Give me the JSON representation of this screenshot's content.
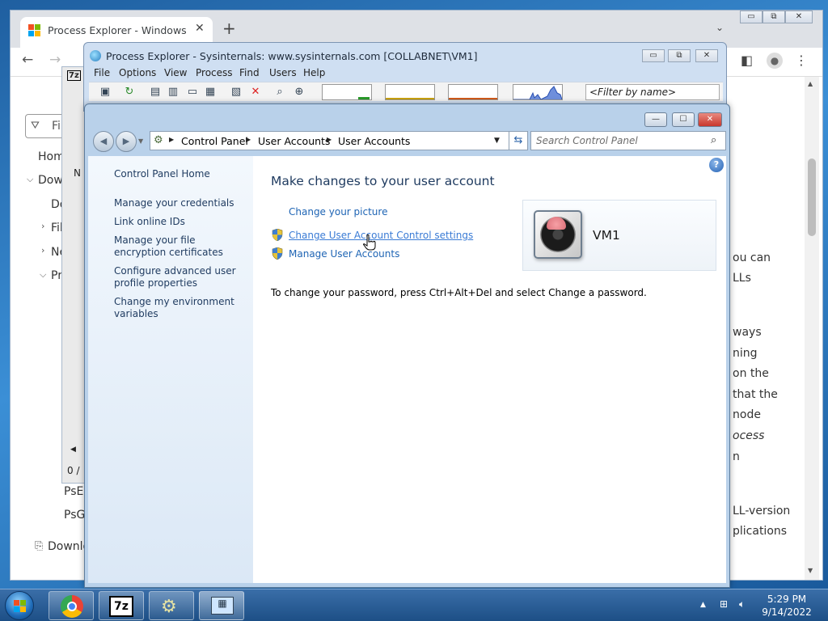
{
  "chrome": {
    "tab_title": "Process Explorer - Windows Sysinternals",
    "tab_close": "✕",
    "new_tab": "+",
    "tab_menu": "⌄",
    "window_controls": {
      "minimize": "▭",
      "restore": "⧉",
      "close": "✕"
    },
    "nav": {
      "back": "←",
      "forward": "→"
    },
    "left_partial": {
      "filter": "Fil",
      "home": "Hom",
      "downloads_section": "Dow",
      "downloads_item": "Do",
      "files_item": "Fil",
      "networking_item": "Ne",
      "process_item": "Pr",
      "ps_item1": "PsE",
      "ps_item2": "PsG",
      "download_link": "Downlo"
    },
    "right_partial": [
      "ou can",
      "LLs",
      "ways",
      "ning",
      "on the",
      "that the",
      "node",
      "ocess",
      "n",
      "LL-version",
      "plications"
    ]
  },
  "sevenzip_bg": {
    "title": "7z",
    "col_header": "N",
    "status": "0 /"
  },
  "process_explorer": {
    "title": "Process Explorer - Sysinternals: www.sysinternals.com [COLLABNET\\VM1]",
    "menu": [
      "File",
      "Options",
      "View",
      "Process",
      "Find",
      "Users",
      "Help"
    ],
    "filter_placeholder": "<Filter by name>"
  },
  "control_panel": {
    "window_controls": {
      "minimize": "—",
      "maximize": "☐",
      "close": "✕"
    },
    "breadcrumb": [
      "Control Panel",
      "User Accounts",
      "User Accounts"
    ],
    "search_placeholder": "Search Control Panel",
    "left_links": [
      "Control Panel Home",
      "Manage your credentials",
      "Link online IDs",
      "Manage your file encryption certificates",
      "Configure advanced user profile properties",
      "Change my environment variables"
    ],
    "heading": "Make changes to your user account",
    "tasks": {
      "change_picture": "Change your picture",
      "change_uac": "Change User Account Control settings",
      "manage_accounts": "Manage User Accounts"
    },
    "password_note": "To change your password, press Ctrl+Alt+Del and select Change a password.",
    "username": "VM1",
    "help": "?"
  },
  "taskbar": {
    "apps": [
      "chrome",
      "7-zip",
      "control-panel",
      "process-explorer"
    ],
    "sevenzip_label": "7z",
    "time": "5:29 PM",
    "date": "9/14/2022"
  },
  "colors": {
    "link": "#1e64b4",
    "heading": "#1e3a5f",
    "taskbar": "#1d4f86",
    "close_button": "#c8372d"
  }
}
